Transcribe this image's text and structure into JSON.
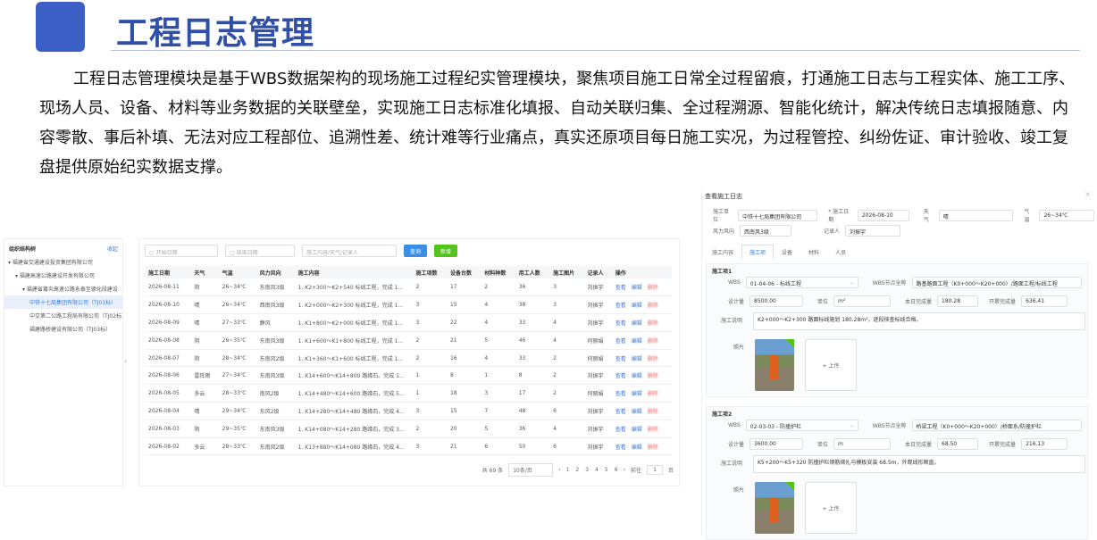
{
  "header": {
    "title": "工程日志管理"
  },
  "intro": "工程日志管理模块是基于WBS数据架构的现场施工过程纪实管理模块，聚焦项目施工日常全过程留痕，打通施工日志与工程实体、施工工序、现场人员、设备、材料等业务数据的关联壁垒，实现施工日志标准化填报、自动关联归集、全过程溯源、智能化统计，解决传统日志填报随意、内容零散、事后补填、无法对应工程部位、追溯性差、统计难等行业痛点，真实还原项目每日施工实况，为过程管控、纠纷佐证、审计验收、竣工复盘提供原始纪实数据支撑。",
  "tree": {
    "title": "组织结构树",
    "collapse": "收起",
    "nodes": [
      {
        "label": "▾ 福建省交通建设投资集团有限公司",
        "indent": 0
      },
      {
        "label": "▾ 福建高速公路建设开发有限公司",
        "indent": 1
      },
      {
        "label": "▾ 福建省莆炎高速公路永泰至德化段建设",
        "indent": 2
      },
      {
        "label": "中铁十七局集团有限公司（TJ01标）",
        "indent": 3,
        "selected": true
      },
      {
        "label": "中交第二公路工程局有限公司（TJ02标）",
        "indent": 3
      },
      {
        "label": "福建路桥建设有限公司（TJ03标）",
        "indent": 3
      }
    ],
    "splitter": "‹"
  },
  "filters": {
    "start": "开始日期",
    "end": "结束日期",
    "keyword": "施工内容/天气/记录人",
    "query": "查询",
    "add": "新增"
  },
  "table": {
    "columns": [
      "施工日期",
      "天气",
      "气温",
      "风力风向",
      "施工内容",
      "施工项数",
      "设备台数",
      "材料种数",
      "用工人数",
      "施工图片",
      "记录人",
      "操作"
    ],
    "rows": [
      [
        "2026-08-11",
        "阴",
        "26~34℃",
        "东南风3级",
        "1. K2+300～K2+540 标线工程，完成 1...",
        "2",
        "17",
        "2",
        "36",
        "3",
        "刘振宇"
      ],
      [
        "2026-08-10",
        "晴",
        "26~34℃",
        "西南风3级",
        "1. K2+000～K2+300 标线工程，完成 1...",
        "3",
        "15",
        "4",
        "38",
        "3",
        "刘振宇"
      ],
      [
        "2026-08-09",
        "晴",
        "27~33℃",
        "静风",
        "1. K1+800～K2+000 标线工程，完成 1...",
        "3",
        "22",
        "4",
        "33",
        "4",
        "刘振宇"
      ],
      [
        "2026-08-08",
        "阴",
        "26~35℃",
        "东南风3级",
        "1. K1+600～K1+800 标线工程，完成 1...",
        "2",
        "21",
        "5",
        "46",
        "4",
        "何丽娟"
      ],
      [
        "2026-08-07",
        "阴",
        "28~34℃",
        "东南风2级",
        "1. K1+360～K1+600 标线工程，完成 1...",
        "2",
        "16",
        "4",
        "33",
        "2",
        "何丽娟"
      ],
      [
        "2026-08-06",
        "雷阵雨",
        "27~34℃",
        "东南风3级",
        "1. K14+600～K14+800 路缘石。完成 1...",
        "1",
        "8",
        "1",
        "8",
        "2",
        "刘振宇"
      ],
      [
        "2026-08-05",
        "多云",
        "28~33℃",
        "南风2级",
        "1. K14+480～K14+600 路缘石，完成 5...",
        "1",
        "18",
        "3",
        "17",
        "2",
        "何丽娟"
      ],
      [
        "2026-08-04",
        "晴",
        "29~34℃",
        "东风2级",
        "1. K14+280～K14+480 路缘石，完成 4...",
        "3",
        "15",
        "7",
        "48",
        "6",
        "刘振宇"
      ],
      [
        "2026-08-03",
        "阴",
        "29~35℃",
        "东南风3级",
        "1. K14+080～K14+280 路缘石，完成 3...",
        "2",
        "20",
        "5",
        "36",
        "4",
        "刘振宇"
      ],
      [
        "2026-08-02",
        "多云",
        "28~33℃",
        "东南风2级",
        "1. K13+880～K14+080 路缘石，完成 4...",
        "3",
        "21",
        "6",
        "50",
        "6",
        "刘振宇"
      ]
    ],
    "actions": {
      "view": "查看",
      "edit": "编辑",
      "delete": "删除"
    }
  },
  "pager": {
    "total": "共 69 条",
    "size": "10条/页",
    "pages": [
      "1",
      "2",
      "3",
      "4",
      "5",
      "6"
    ],
    "prev": "‹",
    "next": "›",
    "goto": "前往",
    "page": "1",
    "unit": "页"
  },
  "detail": {
    "title": "查看施工日志",
    "close": "×",
    "unit_label": "施工单位",
    "unit_value": "中铁十七局集团有限公司",
    "date_label": "* 施工日期",
    "date_value": "2026-08-10",
    "weather_label": "天气",
    "weather_value": "晴",
    "temp_label": "气温",
    "temp_value": "26~34℃",
    "wind_label": "风力风向",
    "wind_value": "西南风3级",
    "recorder_label": "记录人",
    "recorder_value": "刘振宇",
    "tabs": [
      "施工内容",
      "施工项",
      "设备",
      "材料",
      "人员"
    ],
    "items": [
      {
        "title": "施工项1",
        "wbs_label": "WBS",
        "wbs": "01-04-06 - 标线工程",
        "node_label": "WBS节点全称",
        "node": "路基路面工程（K0+000～K20+000）/路面工程/标线工程",
        "qty_label": "设计量",
        "qty": "8500.00",
        "unit_label": "单位",
        "unit": "m²",
        "today_label": "本日完成量",
        "today": "180.28",
        "total_label": "开累完成量",
        "total": "636.41",
        "desc_label": "施工说明",
        "desc": "K2+000～K2+300 路面标线施划 180.28m²，逐段核查标线合格。",
        "photo_label": "照片",
        "upload": "+ 上传"
      },
      {
        "title": "施工项2",
        "wbs_label": "WBS",
        "wbs": "02-03-03 - 防撞护栏",
        "node_label": "WBS节点全称",
        "node": "桥梁工程（K0+000～K20+000）/桥面系/防撞护栏",
        "qty_label": "设计量",
        "qty": "3600.00",
        "unit_label": "单位",
        "unit": "m",
        "today_label": "本日完成量",
        "today": "68.50",
        "total_label": "开累完成量",
        "total": "216.13",
        "desc_label": "施工说明",
        "desc": "K5+200～K5+320 防撞护栏钢筋绑扎与模板安装 68.5m，外观线形顺直。",
        "photo_label": "照片",
        "upload": "+ 上传"
      }
    ]
  }
}
